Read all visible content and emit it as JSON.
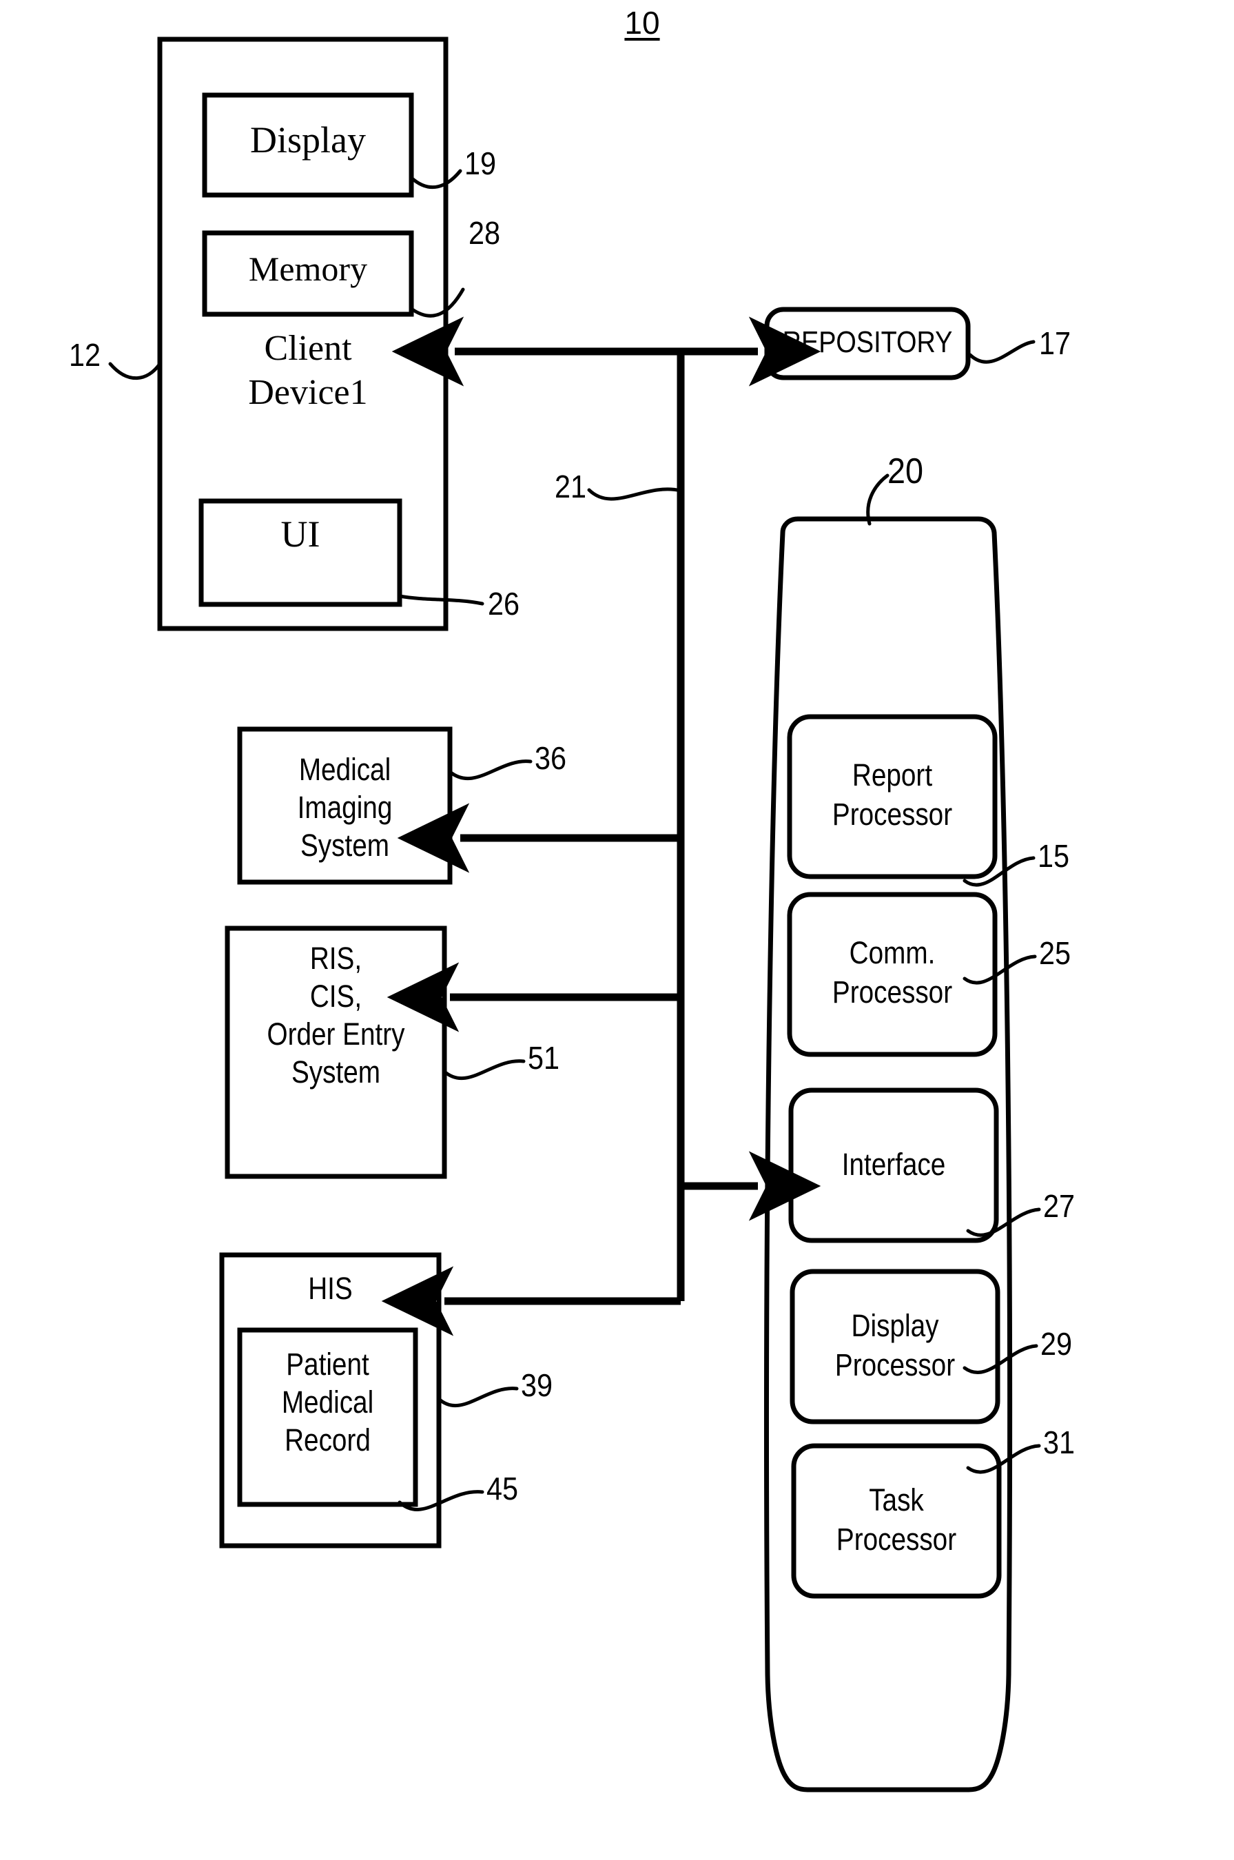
{
  "figure": {
    "number": "10",
    "type": "patent-block-diagram",
    "background_color": "#ffffff",
    "line_color": "#000000"
  },
  "client_device": {
    "label": "Client\nDevice1",
    "ref": "12",
    "children": [
      {
        "label": "Display",
        "ref": "19"
      },
      {
        "label": "Memory",
        "ref": "28"
      },
      {
        "label": "UI",
        "ref": "26"
      }
    ]
  },
  "repository": {
    "label": "REPOSITORY",
    "ref": "17"
  },
  "bus": {
    "ref": "21"
  },
  "server": {
    "ref": "20",
    "modules": [
      {
        "label": "Report\nProcessor",
        "ref": "15"
      },
      {
        "label": "Comm.\nProcessor",
        "ref": "25"
      },
      {
        "label": "Interface",
        "ref": "27"
      },
      {
        "label": "Display\nProcessor",
        "ref": "29"
      },
      {
        "label": "Task\nProcessor",
        "ref": "31"
      }
    ]
  },
  "external_systems": [
    {
      "label": "Medical\nImaging\nSystem",
      "ref": "36"
    },
    {
      "label": "RIS,\nCIS,\nOrder Entry\nSystem",
      "ref": "51"
    },
    {
      "label": "HIS",
      "ref": "39",
      "child": {
        "label": "Patient\nMedical\nRecord",
        "ref": "45"
      }
    }
  ],
  "reference_numerals": {
    "n10": "10",
    "n12": "12",
    "n15": "15",
    "n17": "17",
    "n19": "19",
    "n20": "20",
    "n21": "21",
    "n25": "25",
    "n26": "26",
    "n27": "27",
    "n28": "28",
    "n29": "29",
    "n31": "31",
    "n36": "36",
    "n39": "39",
    "n45": "45",
    "n51": "51"
  },
  "labels": {
    "display": "Display",
    "memory": "Memory",
    "client_device_line1": "Client",
    "client_device_line2": "Device1",
    "ui": "UI",
    "repository": "REPOSITORY",
    "report_processor_l1": "Report",
    "report_processor_l2": "Processor",
    "comm_processor_l1": "Comm.",
    "comm_processor_l2": "Processor",
    "interface": "Interface",
    "display_processor_l1": "Display",
    "display_processor_l2": "Processor",
    "task_processor_l1": "Task",
    "task_processor_l2": "Processor",
    "medical_imaging_l1": "Medical",
    "medical_imaging_l2": "Imaging",
    "medical_imaging_l3": "System",
    "ris_l1": "RIS,",
    "ris_l2": "CIS,",
    "ris_l3": "Order Entry",
    "ris_l4": "System",
    "his": "HIS",
    "pmr_l1": "Patient",
    "pmr_l2": "Medical",
    "pmr_l3": "Record"
  }
}
